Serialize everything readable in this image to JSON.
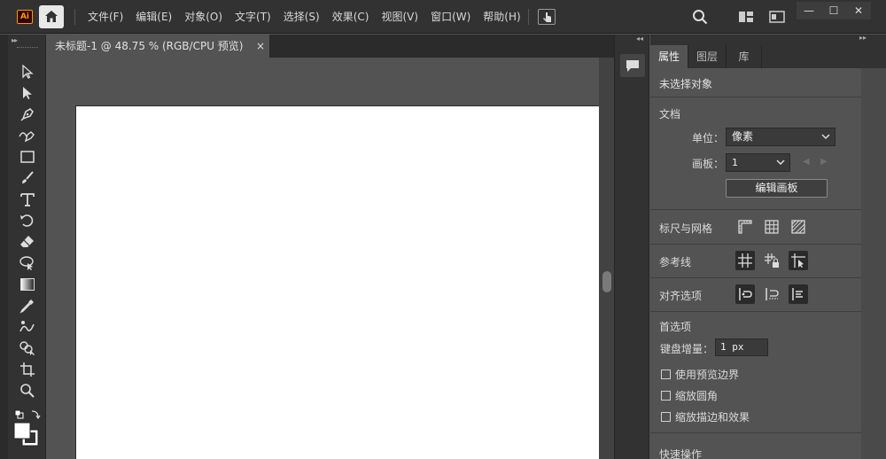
{
  "app": {
    "logo_text": "Ai",
    "menu": [
      "文件(F)",
      "编辑(E)",
      "对象(O)",
      "文字(T)",
      "选择(S)",
      "效果(C)",
      "视图(V)",
      "窗口(W)",
      "帮助(H)"
    ],
    "window_controls": {
      "minimize": "—",
      "maximize": "☐",
      "close": "✕"
    }
  },
  "document": {
    "tab_title": "未标题-1 @ 48.75 % (RGB/CPU 预览)",
    "tab_close": "×"
  },
  "panel": {
    "tabs": [
      "属性",
      "图层",
      "库"
    ],
    "active_tab": 0,
    "no_selection": "未选择对象",
    "document_section": "文档",
    "units_label": "单位：",
    "units_value": "像素",
    "artboard_label": "画板：",
    "artboard_value": "1",
    "edit_artboard_button": "编辑画板",
    "rulers_grids": "标尺与网格",
    "guides": "参考线",
    "snap_options": "对齐选项",
    "preferences": "首选项",
    "keyboard_increment_label": "键盘增量：",
    "keyboard_increment_value": "1 px",
    "checkboxes": [
      "使用预览边界",
      "缩放圆角",
      "缩放描边和效果"
    ],
    "quick_actions": "快速操作"
  },
  "colors": {
    "chrome": "#323232",
    "canvas": "#535353",
    "artboard": "#ffffff",
    "accent_logo": "#ff9a00"
  },
  "icons": {
    "toolbar": [
      "selection-tool-icon",
      "direct-selection-tool-icon",
      "pen-tool-icon",
      "curvature-tool-icon",
      "rectangle-tool-icon",
      "paintbrush-tool-icon",
      "type-tool-icon",
      "rotate-tool-icon",
      "eraser-tool-icon",
      "lasso-tool-icon",
      "gradient-tool-icon",
      "eyedropper-tool-icon",
      "puppet-warp-tool-icon",
      "shape-builder-tool-icon",
      "artboard-tool-icon",
      "zoom-tool-icon"
    ]
  }
}
